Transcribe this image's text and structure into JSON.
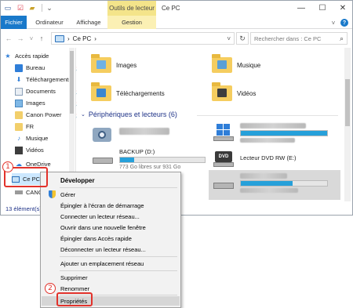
{
  "titlebar": {
    "contextual_tab_header": "Outils de lecteur",
    "window_title": "Ce PC",
    "minimize": "—",
    "maximize": "☐",
    "close": "✕"
  },
  "ribbon": {
    "tabs": [
      {
        "label": "Fichier"
      },
      {
        "label": "Ordinateur"
      },
      {
        "label": "Affichage"
      },
      {
        "label": "Gestion"
      }
    ],
    "collapse_glyph": "˅",
    "help_glyph": "?"
  },
  "address": {
    "back": "←",
    "forward": "→",
    "recent": "˅",
    "up": "↑",
    "path_separator": "›",
    "path": "Ce PC",
    "path_end": "›",
    "dropdown": "˅",
    "refresh": "↻",
    "search_placeholder": "Rechercher dans : Ce PC",
    "search_glyph": "⌕"
  },
  "navpane": {
    "items": [
      {
        "label": "Accès rapide",
        "pinned": false
      },
      {
        "label": "Bureau",
        "pinned": true
      },
      {
        "label": "Téléchargements",
        "pinned": true
      },
      {
        "label": "Documents",
        "pinned": true
      },
      {
        "label": "Images",
        "pinned": true
      },
      {
        "label": "Canon Power",
        "pinned": true
      },
      {
        "label": "FR",
        "pinned": false
      },
      {
        "label": "Musique",
        "pinned": false
      },
      {
        "label": "Vidéos",
        "pinned": false
      },
      {
        "label": "OneDrive",
        "pinned": false
      },
      {
        "label": "Ce PC",
        "pinned": false
      },
      {
        "label": "CANON",
        "pinned": false
      }
    ],
    "pin_glyph": "📌"
  },
  "content": {
    "folders": [
      {
        "label": "Images"
      },
      {
        "label": "Musique"
      },
      {
        "label": "Téléchargements"
      },
      {
        "label": "Vidéos"
      }
    ],
    "devices_header": "Périphériques et lecteurs (6)",
    "drives": [
      {
        "label": "BACKUP (D:)",
        "sub": "773 Go libres sur 931 Go",
        "used_fraction": 0.17
      },
      {
        "label": "Lecteur DVD RW (E:)",
        "sub": "",
        "used_fraction": null
      }
    ]
  },
  "status": {
    "text": "13 élément(s)"
  },
  "context_menu": {
    "items": [
      {
        "label": "Développer",
        "bold": true
      },
      {
        "label": "Gérer"
      },
      {
        "label": "Épingler à l'écran de démarrage"
      },
      {
        "label": "Connecter un lecteur réseau..."
      },
      {
        "label": "Ouvrir dans une nouvelle fenêtre"
      },
      {
        "label": "Épingler dans Accès rapide"
      },
      {
        "label": "Déconnecter un lecteur réseau..."
      },
      {
        "label": "Ajouter un emplacement réseau"
      },
      {
        "label": "Supprimer"
      },
      {
        "label": "Renommer"
      },
      {
        "label": "Propriétés"
      }
    ]
  },
  "callouts": {
    "step1": "1",
    "step2": "2",
    "color": "#e2322b"
  }
}
